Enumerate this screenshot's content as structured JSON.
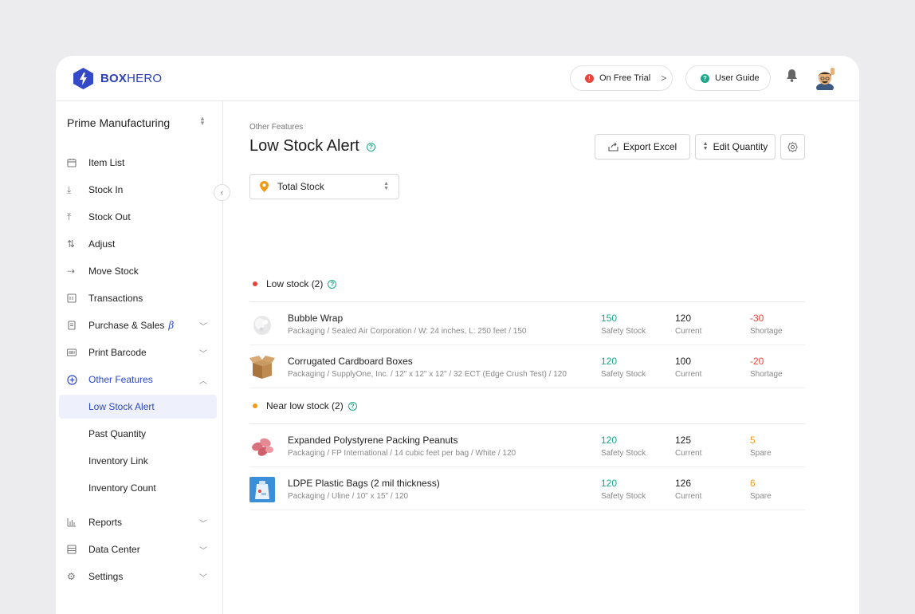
{
  "brand": {
    "bold": "BOX",
    "light": "HERO"
  },
  "header": {
    "trial_label": "On Free Trial",
    "guide_label": "User Guide"
  },
  "sidebar": {
    "company": "Prime Manufacturing",
    "items": [
      {
        "label": "Item List",
        "icon": "calendar-icon"
      },
      {
        "label": "Stock In",
        "icon": "arrow-down-icon"
      },
      {
        "label": "Stock Out",
        "icon": "arrow-up-icon"
      },
      {
        "label": "Adjust",
        "icon": "swap-icon"
      },
      {
        "label": "Move Stock",
        "icon": "arrow-right-icon"
      },
      {
        "label": "Transactions",
        "icon": "ledger-icon"
      },
      {
        "label": "Purchase & Sales",
        "icon": "document-icon",
        "badge": "β"
      },
      {
        "label": "Print Barcode",
        "icon": "barcode-icon"
      },
      {
        "label": "Other Features",
        "icon": "plus-circle-icon"
      },
      {
        "label": "Low Stock Alert"
      },
      {
        "label": "Past Quantity"
      },
      {
        "label": "Inventory Link"
      },
      {
        "label": "Inventory Count"
      },
      {
        "label": "Reports",
        "icon": "bar-chart-icon"
      },
      {
        "label": "Data Center",
        "icon": "database-icon"
      },
      {
        "label": "Settings",
        "icon": "gear-icon"
      }
    ]
  },
  "main": {
    "breadcrumb": "Other Features",
    "title": "Low Stock Alert",
    "export_label": "Export Excel",
    "edit_label": "Edit Quantity",
    "location": "Total Stock",
    "low_section": "Low stock (2)",
    "near_section": "Near low stock (2)",
    "rows": [
      {
        "name": "Bubble Wrap",
        "meta": "Packaging / Sealed Air Corporation / W: 24 inches, L: 250 feet / 150",
        "safety": "150",
        "safety_label": "Safety Stock",
        "current": "120",
        "current_label": "Current",
        "diff": "-30",
        "diff_label": "Shortage"
      },
      {
        "name": "Corrugated Cardboard Boxes",
        "meta": "Packaging / SupplyOne, Inc. / 12\" x 12\" x 12\" / 32 ECT (Edge Crush Test) / 120",
        "safety": "120",
        "safety_label": "Safety Stock",
        "current": "100",
        "current_label": "Current",
        "diff": "-20",
        "diff_label": "Shortage"
      },
      {
        "name": "Expanded Polystyrene Packing Peanuts",
        "meta": "Packaging / FP International / 14 cubic feet per bag / White / 120",
        "safety": "120",
        "safety_label": "Safety Stock",
        "current": "125",
        "current_label": "Current",
        "diff": "5",
        "diff_label": "Spare"
      },
      {
        "name": "LDPE Plastic Bags (2 mil thickness)",
        "meta": "Packaging / Uline / 10\" x 15\" / 120",
        "safety": "120",
        "safety_label": "Safety Stock",
        "current": "126",
        "current_label": "Current",
        "diff": "6",
        "diff_label": "Spare"
      }
    ]
  },
  "colors": {
    "accent": "#2b48c8",
    "green": "#1aa88a",
    "red": "#e8453c",
    "orange": "#f29a18"
  }
}
